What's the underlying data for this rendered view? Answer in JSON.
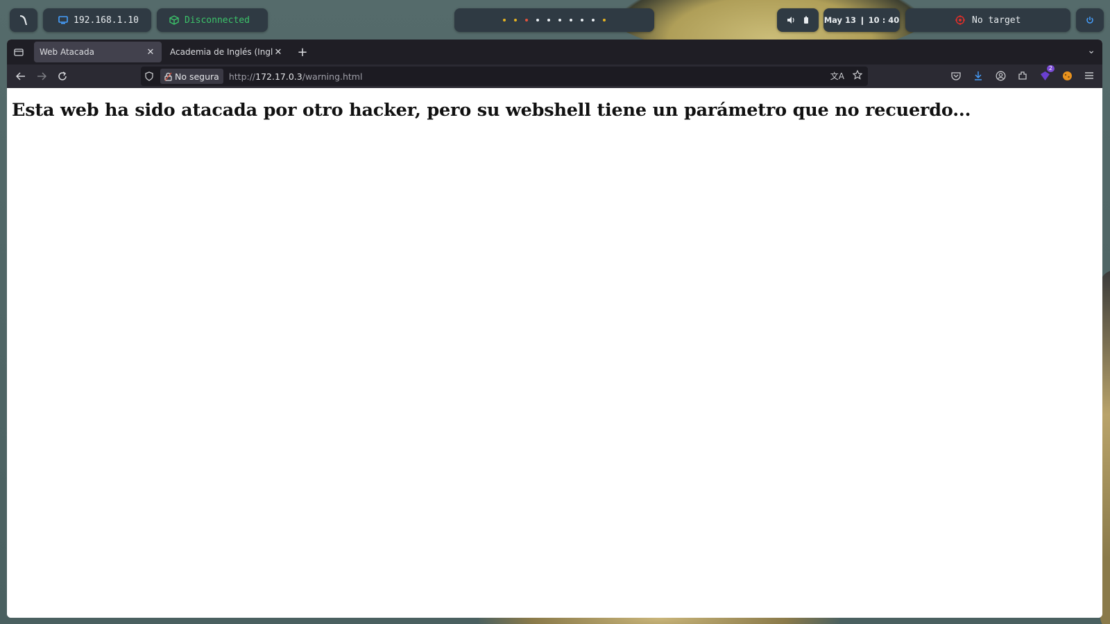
{
  "topbar": {
    "ip_address": "192.168.1.10",
    "vpn_status": "Disconnected",
    "datetime": "May 13 ❙ 10 : 40",
    "target": "No target",
    "colors": {
      "panel": "#2f3a43",
      "vpn": "#3cc46a",
      "target_icon": "#e0302a",
      "power": "#46a0ff"
    }
  },
  "browser": {
    "tabs": [
      {
        "label": "Web Atacada",
        "active": true
      },
      {
        "label": "Academia de Inglés (Inglis A",
        "active": false
      }
    ],
    "urlbar": {
      "security_label": "No segura",
      "url_scheme": "http://",
      "url_host": "172.17.0.3",
      "url_path": "/warning.html"
    },
    "extension_badge": "2"
  },
  "page": {
    "heading": "Esta web ha sido atacada por otro hacker, pero su webshell tiene un parámetro que no recuerdo..."
  }
}
